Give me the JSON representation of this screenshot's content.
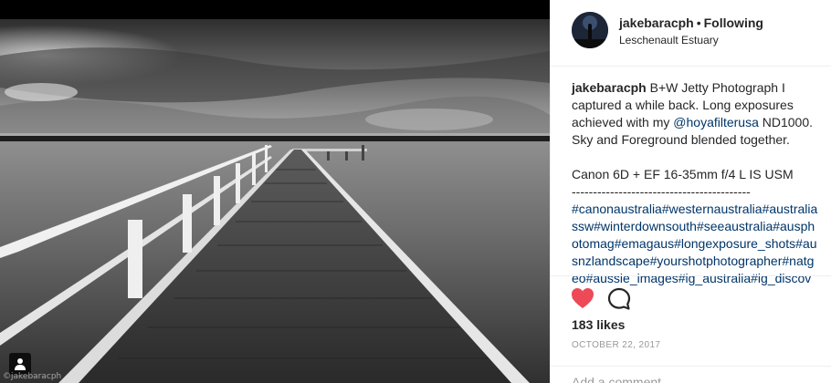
{
  "post": {
    "watermark": "©jakebaracph"
  },
  "header": {
    "username": "jakebaracph",
    "separator": "•",
    "follow_status": "Following",
    "location": "Leschenault Estuary"
  },
  "caption": {
    "username": "jakebaracph",
    "text_part1": "B+W Jetty Photograph I captured a while back. Long exposures achieved with my",
    "mention": "@hoyafilterusa",
    "text_part2": "ND1000. Sky and Foreground blended together.",
    "camera": "Canon 6D + EF 16-35mm f/4 L IS USM",
    "divider": "------------------------------------------",
    "hashtags": "#canonaustralia#westernaustralia#australiassw#winterdownsouth#seeaustralia#ausphotomag#emagaus#longexposure_shots#ausnzlandscape#yourshotphotographer#natgeo#aussie_images#ig_australia#ig_discover"
  },
  "actions": {
    "likes": "183 likes",
    "date": "OCTOBER 22, 2017",
    "add_comment_placeholder": "Add a comment..."
  },
  "icons": {
    "heart": "heart-icon",
    "comment": "comment-icon",
    "tag": "person-tag-icon"
  },
  "colors": {
    "heart": "#ed4956",
    "link": "#003569",
    "muted": "#999999",
    "text": "#262626"
  }
}
